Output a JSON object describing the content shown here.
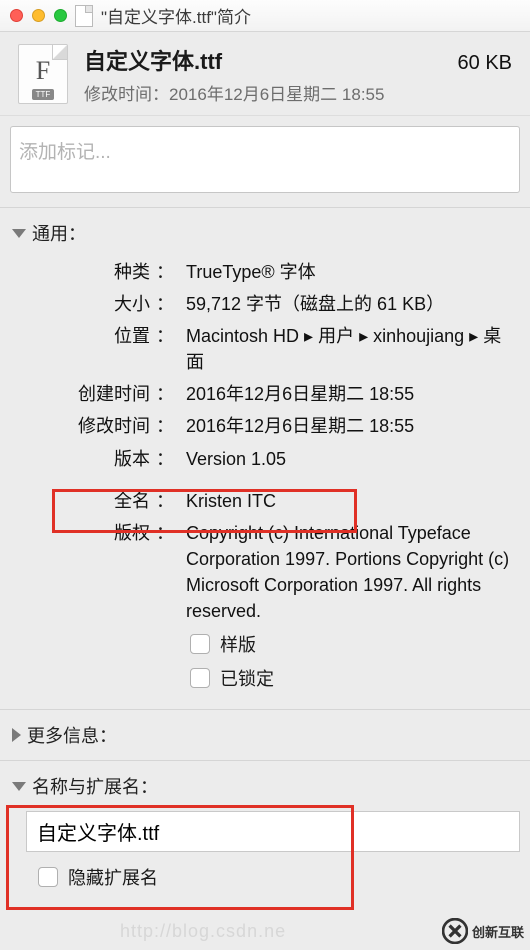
{
  "window": {
    "title": "\"自定义字体.ttf\"简介"
  },
  "header": {
    "icon_letter": "F",
    "icon_ext": "TTF",
    "filename": "自定义字体.ttf",
    "filesize": "60 KB",
    "mod_label": "修改时间：",
    "mod_value": "2016年12月6日星期二 18:55"
  },
  "tags": {
    "placeholder": "添加标记..."
  },
  "sections": {
    "general": {
      "title": "通用：",
      "rows": {
        "kind_label": "种类",
        "kind_value": "TrueType® 字体",
        "size_label": "大小",
        "size_value": "59,712 字节（磁盘上的 61 KB）",
        "where_label": "位置",
        "where_value": "Macintosh HD ▸ 用户 ▸ xinhoujiang ▸ 桌面",
        "created_label": "创建时间",
        "created_value": "2016年12月6日星期二 18:55",
        "modified_label": "修改时间",
        "modified_value": "2016年12月6日星期二 18:55",
        "version_label": "版本",
        "version_value": "Version 1.05",
        "fullname_label": "全名",
        "fullname_value": "Kristen ITC",
        "copyright_label": "版权",
        "copyright_value": "Copyright (c) International Typeface Corporation 1997. Portions Copyright (c) Microsoft Corporation 1997.  All rights reserved.",
        "stationery_label": "样版",
        "locked_label": "已锁定"
      }
    },
    "more": {
      "title": "更多信息："
    },
    "nameext": {
      "title": "名称与扩展名：",
      "input_value": "自定义字体.ttf",
      "hide_ext_label": "隐藏扩展名"
    }
  },
  "watermark": "http://blog.csdn.ne",
  "brand": "创新互联"
}
